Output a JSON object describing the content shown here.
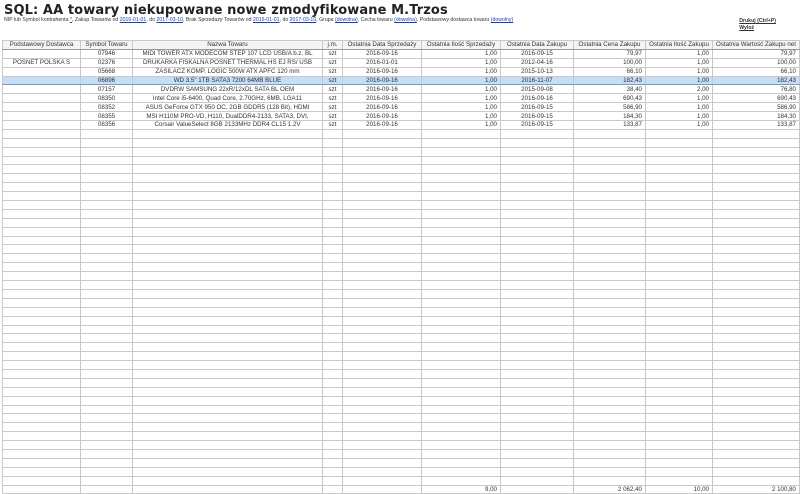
{
  "title": "SQL: AA  towary niekupowane nowe zmodyfikowane M.Trzos",
  "params": {
    "nip_label": "NIP lub Symbol kontrahenta",
    "nip_value": "*",
    "zakup_label": "Zakup Towarów od",
    "zakup_od": "2016-01-01",
    "zakup_do_label": "do",
    "zakup_do": "2017-03-10",
    "brak_label": "Brak Sprzedaży Towarów od",
    "brak_od": "2016-01-01",
    "brak_do_label": "do",
    "brak_do": "2017-03-10",
    "grupa_label": "Grupa",
    "grupa_value": "(dowolna)",
    "cecha_label": "Cecha towaru",
    "cecha_value": "(dowolna)",
    "dostawca_label": "Podstawowy dostawca towaru",
    "dostawca_value": "(dowolny)"
  },
  "actions": {
    "print": "Drukuj (Ctrl+P)",
    "logout": "Wyloż"
  },
  "columns": [
    "Podstawowy Dostawca",
    "Symbol Towaru",
    "Nazwa Towaru",
    "j.m.",
    "Ostatnia Data Sprzedaży",
    "Ostatnia Ilość Sprzedaży",
    "Ostatnia Data Zakupu",
    "Ostatnia Cena Zakupu",
    "Ostatnia Ilość Zakupu",
    "Ostatnia Wartość Zakupu net"
  ],
  "rows": [
    [
      "",
      "07946",
      "MIDI TOWER ATX MODECOM STEP 107 LCD USB/A b.z. BL",
      "szt",
      "2016-09-16",
      "1,00",
      "2016-09-15",
      "79,97",
      "1,00",
      "79,97"
    ],
    [
      "POSNET POLSKA S",
      "02376",
      "DRUKARKA FISKALNA POSNET  THERMAL HS EJ RS/ USB",
      "szt",
      "2016-01-01",
      "1,00",
      "2012-04-16",
      "100,00",
      "1,00",
      "100,00"
    ],
    [
      "",
      "05668",
      "ZASILACZ KOMP.  LOGIC 500W ATX APFC 120 mm",
      "szt",
      "2016-09-16",
      "1,00",
      "2015-10-13",
      "66,10",
      "1,00",
      "66,10"
    ],
    [
      "",
      "06896",
      "WD 3.5\"  1TB SATA3  7200 64MB  BLUE",
      "szt",
      "2016-09-16",
      "1,00",
      "2016-11-07",
      "182,43",
      "1,00",
      "182,43"
    ],
    [
      "",
      "07157",
      "DVDRW SAMSUNG 22xR/12xDL SATA BL OEM",
      "szt",
      "2016-09-16",
      "1,00",
      "2015-09-08",
      "38,40",
      "2,00",
      "76,80"
    ],
    [
      "",
      "08350",
      "Intel Core i5-6400, Quad Core, 2.70GHz, 6MB, LGA11",
      "szt",
      "2016-09-16",
      "1,00",
      "2016-09-16",
      "690,43",
      "1,00",
      "690,43"
    ],
    [
      "",
      "08352",
      "ASUS GeForce GTX 950 OC, 2GB GDDR5 (128 Bit), HDMI",
      "szt",
      "2016-09-16",
      "1,00",
      "2016-09-15",
      "586,90",
      "1,00",
      "586,90"
    ],
    [
      "",
      "08355",
      "MSI H110M PRO-VD, H110, DualDDR4-2133, SATA3, DVI,",
      "szt",
      "2016-09-16",
      "1,00",
      "2016-09-15",
      "184,30",
      "1,00",
      "184,30"
    ],
    [
      "",
      "08356",
      "Corsair ValueSelect 8GB 2133MHz DDR4 CL15 1.2V",
      "szt",
      "2016-09-16",
      "1,00",
      "2016-09-15",
      "133,87",
      "1,00",
      "133,87"
    ]
  ],
  "selected_row": 3,
  "totals": {
    "ilosc_sprzedazy": "9,00",
    "cena_zakupu": "2 062,40",
    "ilosc_zakupu": "10,00",
    "wartosc_zakupu": "2 100,80"
  }
}
